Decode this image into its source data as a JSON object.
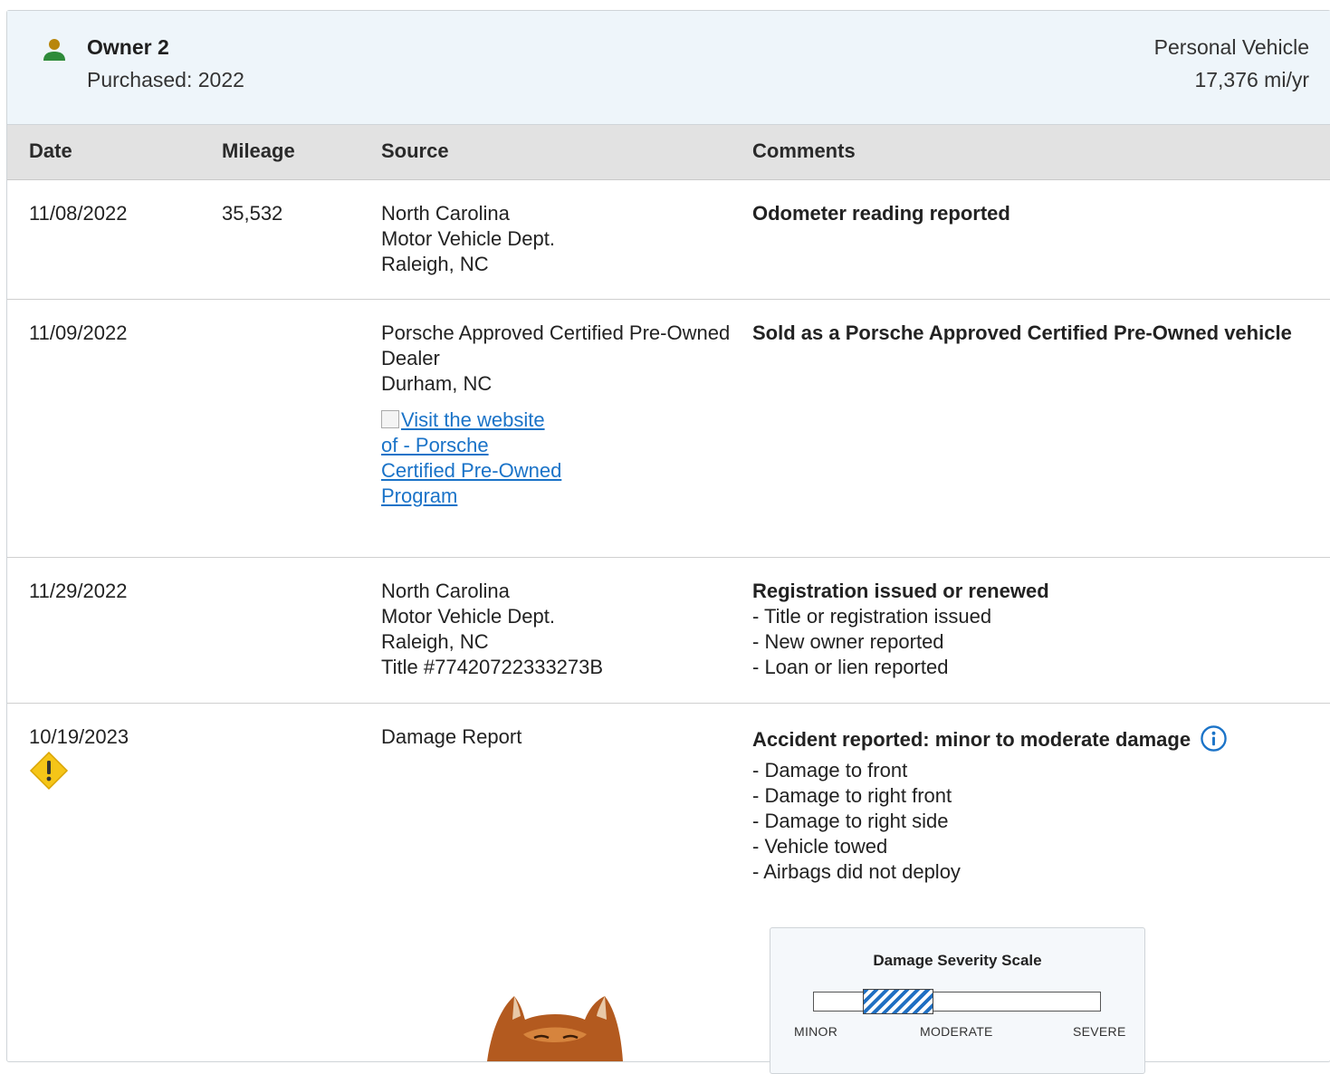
{
  "owner": {
    "title": "Owner 2",
    "purchased": "Purchased: 2022",
    "use_type": "Personal Vehicle",
    "miles_per_year": "17,376 mi/yr",
    "icon": "person-icon",
    "icon_color": "#2e8b3a"
  },
  "table": {
    "headers": {
      "date": "Date",
      "mileage": "Mileage",
      "source": "Source",
      "comments": "Comments"
    }
  },
  "rows": [
    {
      "date": "11/08/2022",
      "mileage": "35,532",
      "source": [
        "North Carolina",
        "Motor Vehicle Dept.",
        "Raleigh, NC"
      ],
      "comment_title": "Odometer reading reported"
    },
    {
      "date": "11/09/2022",
      "mileage": "",
      "source": [
        "Porsche Approved Certified Pre-Owned",
        "Dealer",
        "Durham, NC"
      ],
      "link_text": "Visit the website of - Porsche Certified Pre-Owned Program",
      "comment_title": "Sold as a Porsche Approved Certified Pre-Owned vehicle"
    },
    {
      "date": "11/29/2022",
      "mileage": "",
      "source": [
        "North Carolina",
        "Motor Vehicle Dept.",
        "Raleigh, NC",
        "Title #77420722333273B"
      ],
      "comment_title": "Registration issued or renewed",
      "bullets": [
        "- Title or registration issued",
        "- New owner reported",
        "- Loan or lien reported"
      ]
    },
    {
      "date": "10/19/2023",
      "mileage": "",
      "source": [
        "Damage Report"
      ],
      "comment_title": "Accident reported: minor to moderate damage",
      "bullets": [
        "- Damage to front",
        "- Damage to right front",
        "- Damage to right side",
        "- Vehicle towed",
        "- Airbags did not deploy"
      ],
      "status_icon": "warning-icon",
      "info_icon": "info-icon"
    }
  ],
  "severity_scale": {
    "title": "Damage Severity Scale",
    "labels": [
      "MINOR",
      "MODERATE",
      "SEVERE"
    ],
    "level_range": [
      0.17,
      0.41
    ],
    "fill_color": "#1f6fc2"
  },
  "colors": {
    "link": "#1a73c8",
    "warning": "#f5c518",
    "info": "#1a73c8",
    "header_bg": "#eef5fa",
    "table_head_bg": "#e2e2e2"
  }
}
